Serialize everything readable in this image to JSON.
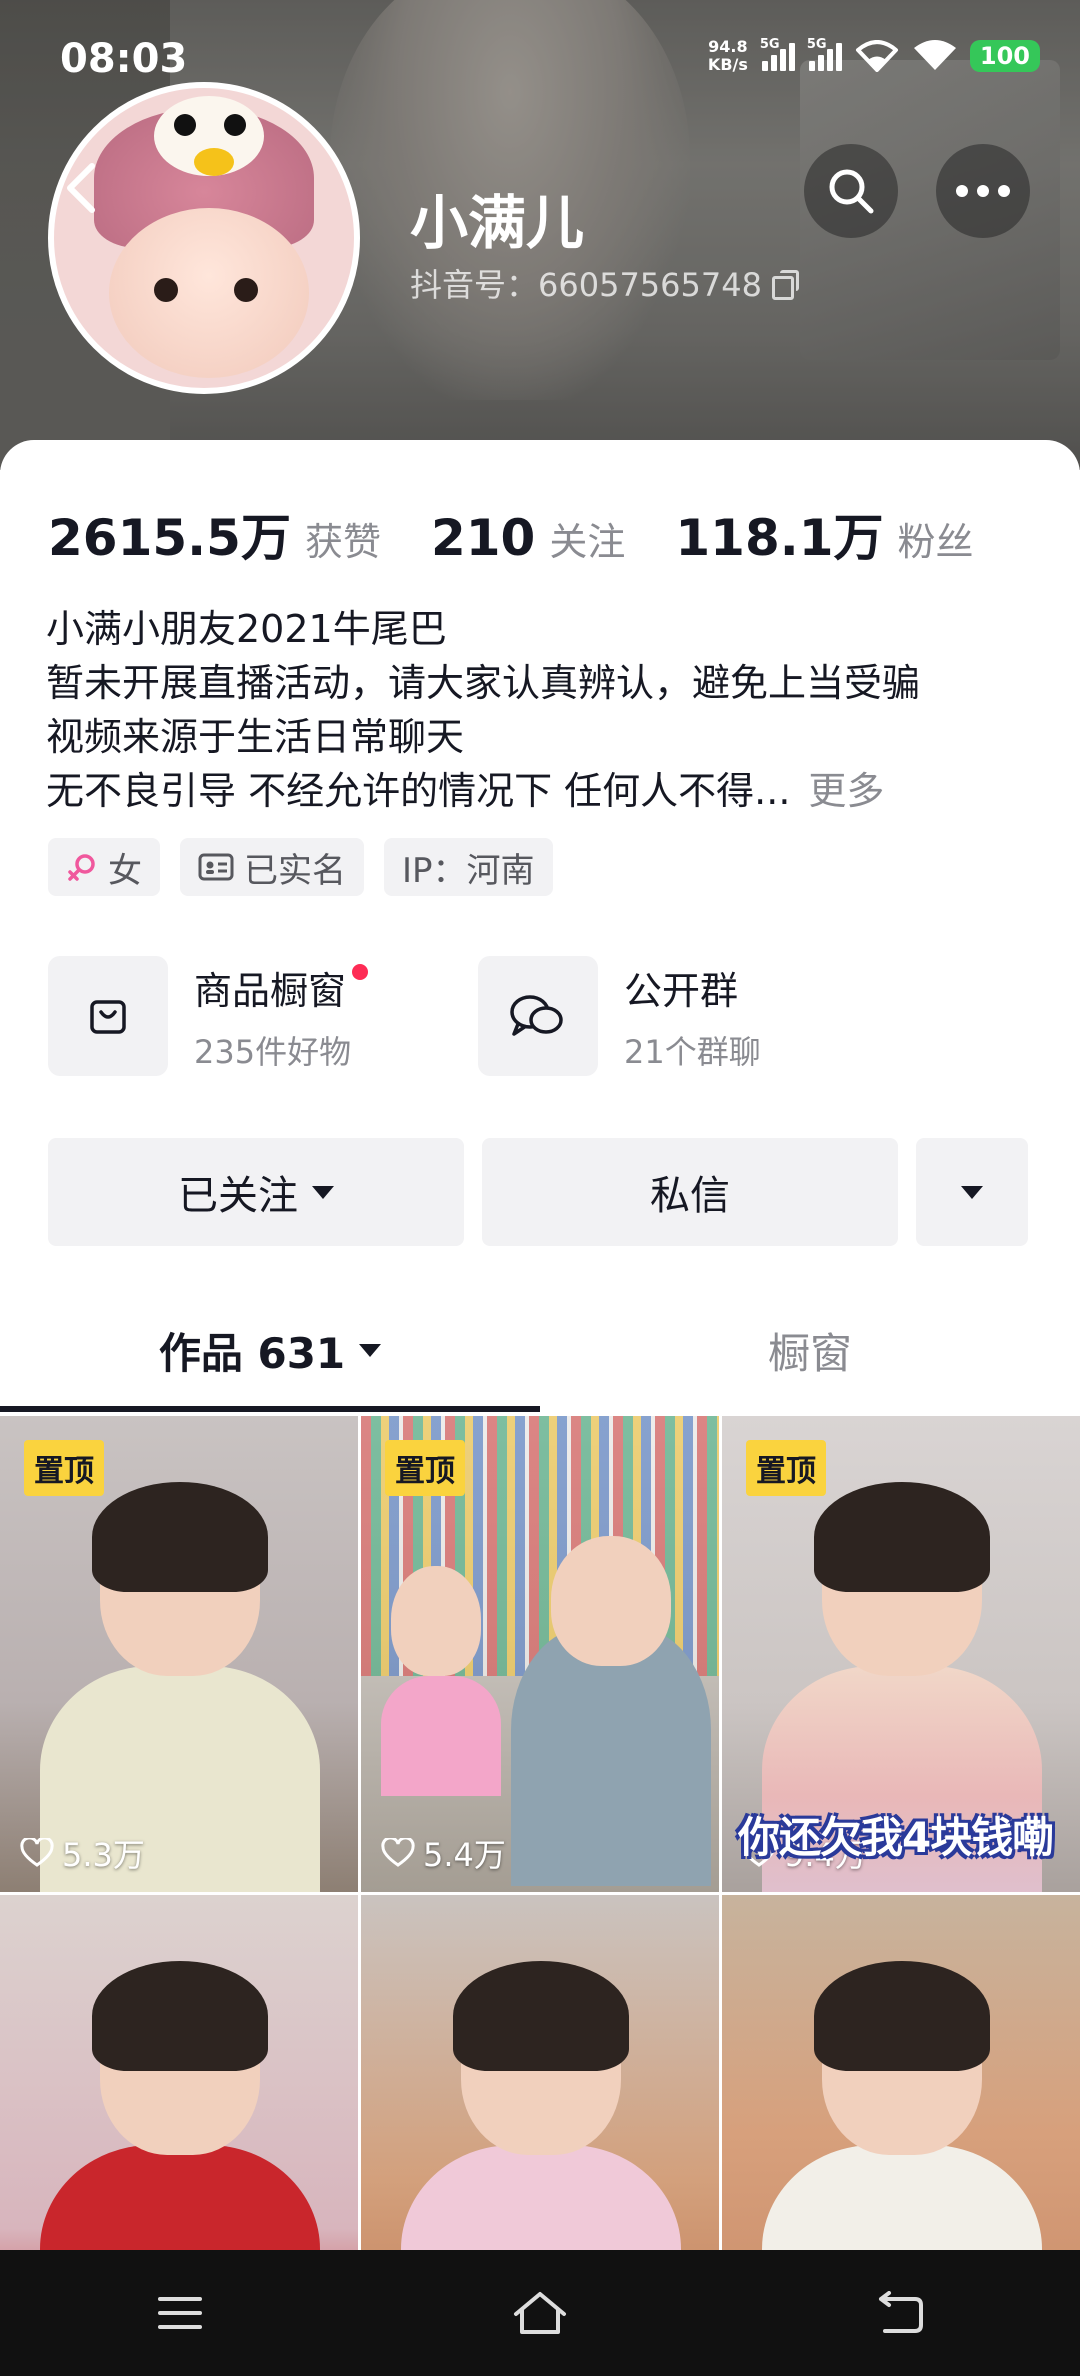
{
  "status_bar": {
    "time": "08:03",
    "net_speed_value": "94.8",
    "net_speed_unit": "KB/s",
    "signal1_label": "5G",
    "signal2_label": "5G",
    "battery": "100"
  },
  "profile": {
    "name": "小满儿",
    "douyin_id": "抖音号：66057565748"
  },
  "stats": [
    {
      "value": "2615.5万",
      "label": "获赞"
    },
    {
      "value": "210",
      "label": "关注"
    },
    {
      "value": "118.1万",
      "label": "粉丝"
    }
  ],
  "bio": {
    "lines": [
      "小满小朋友2021牛尾巴",
      "暂未开展直播活动，请大家认真辨认，避免上当受骗",
      "视频来源于生活日常聊天",
      "无不良引导  不经允许的情况下 任何人不得..."
    ],
    "more": "更多"
  },
  "tags": {
    "gender": "女",
    "verified": "已实名",
    "ip": "IP：河南"
  },
  "shortcuts": {
    "shop": {
      "title": "商品橱窗",
      "subtitle": "235件好物"
    },
    "group": {
      "title": "公开群",
      "subtitle": "21个群聊"
    }
  },
  "actions": {
    "follow": "已关注",
    "message": "私信"
  },
  "tabs": {
    "works": "作品 631",
    "showcase": "橱窗"
  },
  "videos": [
    {
      "pinned": "置顶",
      "likes": "5.3万"
    },
    {
      "pinned": "置顶",
      "likes": "5.4万"
    },
    {
      "pinned": "置顶",
      "likes": "9.4万",
      "caption": "你还欠我4块钱嘞"
    },
    {},
    {},
    {}
  ],
  "colors": {
    "accent": "#fe2c55",
    "pin_badge": "#fad33e",
    "battery": "#35c759"
  }
}
